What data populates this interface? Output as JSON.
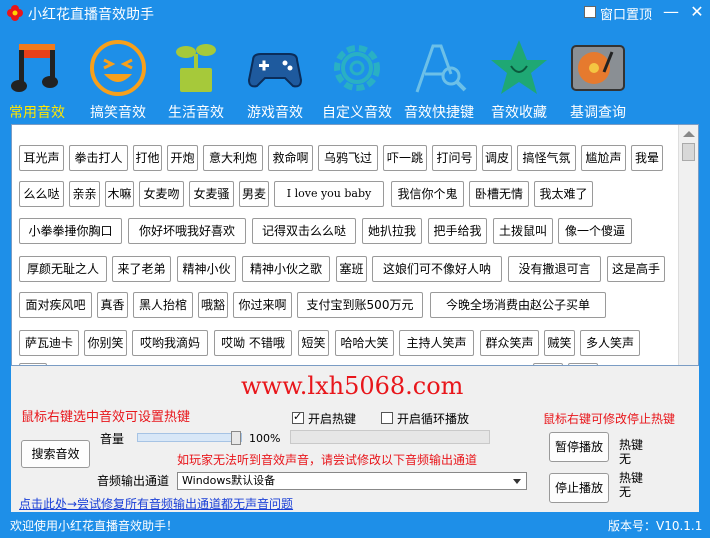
{
  "window": {
    "title": "小红花直播音效助手",
    "pin_label": "窗口置顶",
    "minimize": "—",
    "close": "✕"
  },
  "nav": [
    {
      "label": "常用音效",
      "icon": "music-note-icon",
      "active": true
    },
    {
      "label": "搞笑音效",
      "icon": "laughing-face-icon",
      "active": false
    },
    {
      "label": "生活音效",
      "icon": "plant-pot-icon",
      "active": false
    },
    {
      "label": "游戏音效",
      "icon": "gamepad-icon",
      "active": false
    },
    {
      "label": "自定义音效",
      "icon": "gear-icon",
      "active": false
    },
    {
      "label": "音效快捷键",
      "icon": "search-letter-icon",
      "active": false
    },
    {
      "label": "音效收藏",
      "icon": "star-icon",
      "active": false
    },
    {
      "label": "基调查询",
      "icon": "record-player-icon",
      "active": false
    }
  ],
  "sounds": [
    [
      "耳光声",
      "拳击打人",
      "打他",
      "开炮",
      "意大利炮",
      "救命啊",
      "乌鸦飞过",
      "吓一跳",
      "打问号",
      "调皮",
      "搞怪气氛",
      "尴尬声",
      "我晕"
    ],
    [
      "么么哒",
      "亲亲",
      "木嘛",
      "女麦吻",
      "女麦骚",
      "男麦",
      "I love you baby",
      "我信你个鬼",
      "卧槽无情",
      "我太难了"
    ],
    [
      "小拳拳捶你胸口",
      "你好坏哦我好喜欢",
      "记得双击么么哒",
      "她扒拉我",
      "把手给我",
      "土拨鼠叫",
      "像一个傻逼"
    ],
    [
      "厚颜无耻之人",
      "来了老弟",
      "精神小伙",
      "精神小伙之歌",
      "塞班",
      "这娘们可不像好人呐",
      "没有撒退可言",
      "这是高手"
    ],
    [
      "面对疾风吧",
      "真香",
      "黑人抬棺",
      "哦豁",
      "你过来啊",
      "支付宝到账500万元",
      "今晚全场消费由赵公子买单"
    ],
    [
      "萨瓦迪卡",
      "你别笑",
      "哎哟我滴妈",
      "哎呦 不错哦",
      "短笑",
      "哈哈大笑",
      "主持人笑声",
      "群众笑声",
      "贼笑",
      "多人笑声"
    ]
  ],
  "controls": {
    "watermark": "www.lxh5068.com",
    "hotkey_tip": "鼠标右键选中音效可设置热键",
    "enable_hotkey": "开启热键",
    "enable_hotkey_checked": true,
    "loop_play": "开启循环播放",
    "loop_play_checked": false,
    "stop_tip": "鼠标右键可修改停止热键",
    "volume_label": "音量",
    "volume_value": "100%",
    "volume_level": 1.0,
    "search_button": "搜索音效",
    "pause_button": "暂停播放",
    "stop_button": "停止播放",
    "hotkey_label_1": "热键",
    "hotkey_value_1": "无",
    "hotkey_label_2": "热键",
    "hotkey_value_2": "无",
    "output_warning": "如玩家无法听到音效声音，请尝试修改以下音频输出通道",
    "output_label": "音频输出通道",
    "output_value": "Windows默认设备",
    "fix_link": "点击此处→尝试修复所有音频输出通道都无声音问题"
  },
  "status": {
    "welcome": "欢迎使用小红花直播音效助手！",
    "version": "版本号：V10.1.1"
  },
  "colors": {
    "accent": "#1e8fe8",
    "active_nav": "#ffe600",
    "red_text": "#e8161b",
    "link": "#1a3fd6"
  }
}
